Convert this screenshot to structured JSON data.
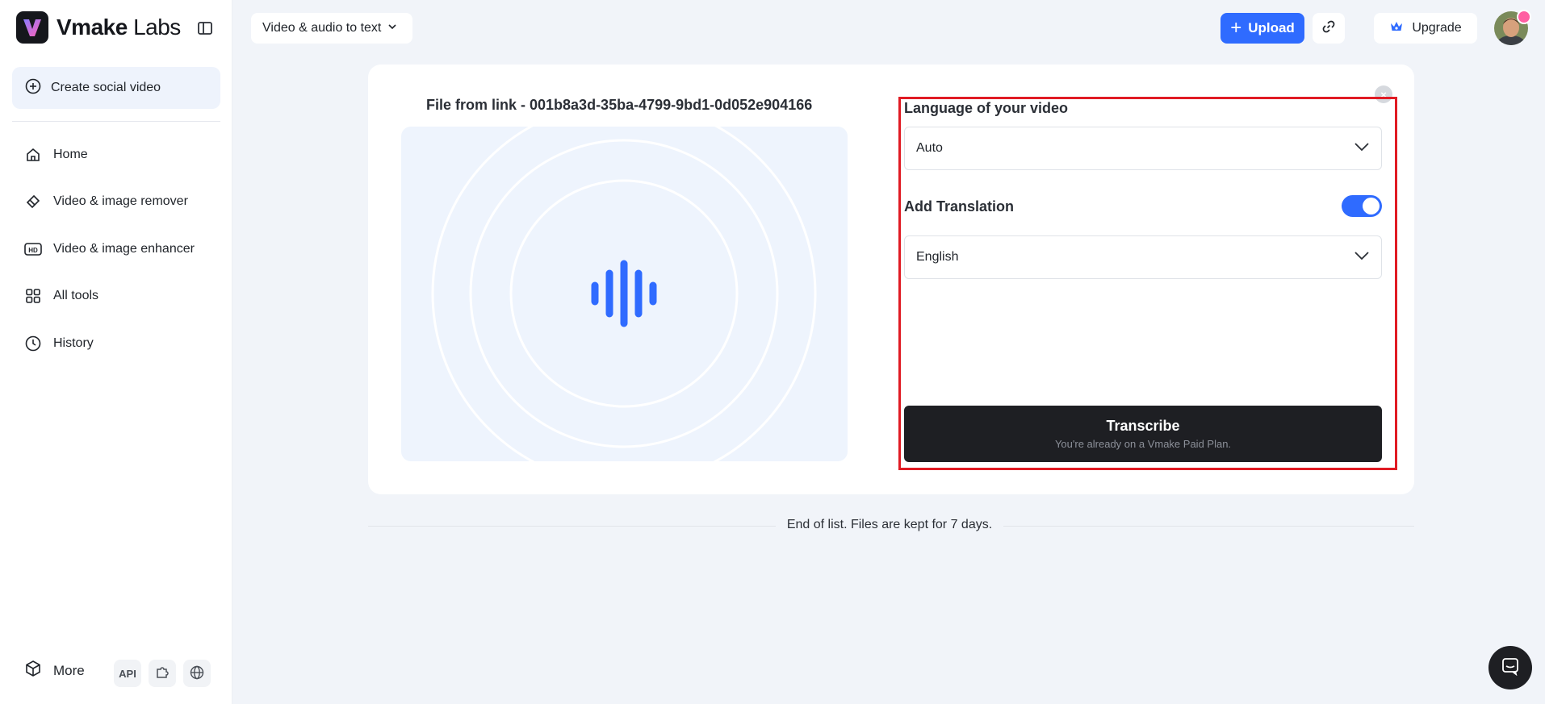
{
  "brand": {
    "name_bold": "Vmake",
    "name_light": "Labs"
  },
  "sidebar": {
    "create_label": "Create social video",
    "items": [
      {
        "label": "Home",
        "icon": "home-icon"
      },
      {
        "label": "Video & image remover",
        "icon": "eraser-icon"
      },
      {
        "label": "Video & image enhancer",
        "icon": "hd-icon"
      },
      {
        "label": "All tools",
        "icon": "grid-icon"
      },
      {
        "label": "History",
        "icon": "clock-icon"
      }
    ],
    "more_label": "More",
    "api_label": "API"
  },
  "topbar": {
    "tool_select": "Video & audio to text",
    "upload_label": "Upload",
    "upgrade_label": "Upgrade"
  },
  "main": {
    "file_title": "File from link - 001b8a3d-35ba-4799-9bd1-0d052e904166",
    "language_label": "Language of your video",
    "language_value": "Auto",
    "translation_label": "Add Translation",
    "translation_enabled": true,
    "translation_value": "English",
    "transcribe_label": "Transcribe",
    "transcribe_sub": "You're already on a Vmake Paid Plan.",
    "end_text": "End of list. Files are kept for 7 days."
  },
  "colors": {
    "accent": "#2f6bff",
    "dark": "#1e1f23",
    "highlight": "#e01b24"
  }
}
